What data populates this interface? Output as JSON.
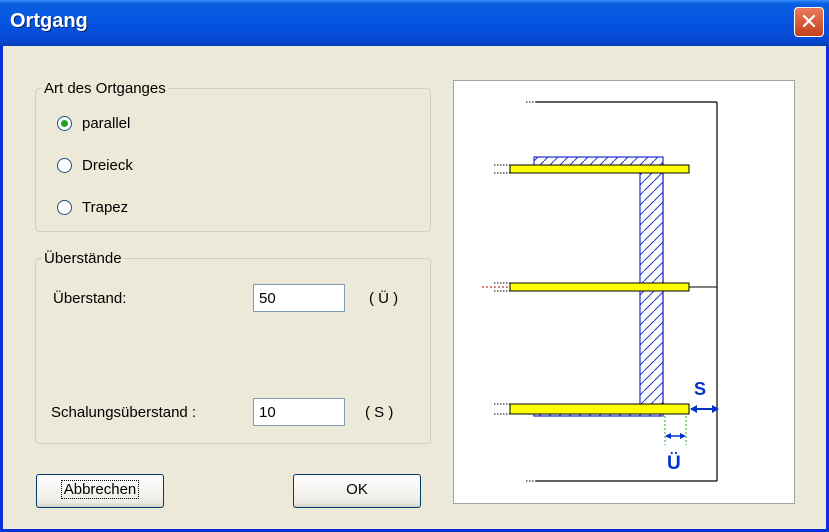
{
  "dialog": {
    "title": "Ortgang",
    "close_glyph": "✕"
  },
  "art_group": {
    "legend": "Art des Ortganges",
    "options": [
      {
        "label": "parallel",
        "selected": true
      },
      {
        "label": "Dreieck",
        "selected": false
      },
      {
        "label": "Trapez",
        "selected": false
      }
    ]
  },
  "ueberstaende_group": {
    "legend": "Überstände",
    "ueberstand": {
      "label": "Überstand:",
      "value": "50",
      "symbol": "( Ü )"
    },
    "schalung": {
      "label": "Schalungsüberstand :",
      "value": "10",
      "symbol": "( S )"
    }
  },
  "buttons": {
    "cancel": "Abbrechen",
    "ok": "OK"
  },
  "preview": {
    "label_s": "S",
    "label_u": "Ü"
  },
  "colors": {
    "accent": "#0554e3",
    "board": "#ffff00",
    "dim": "#0033cc"
  }
}
